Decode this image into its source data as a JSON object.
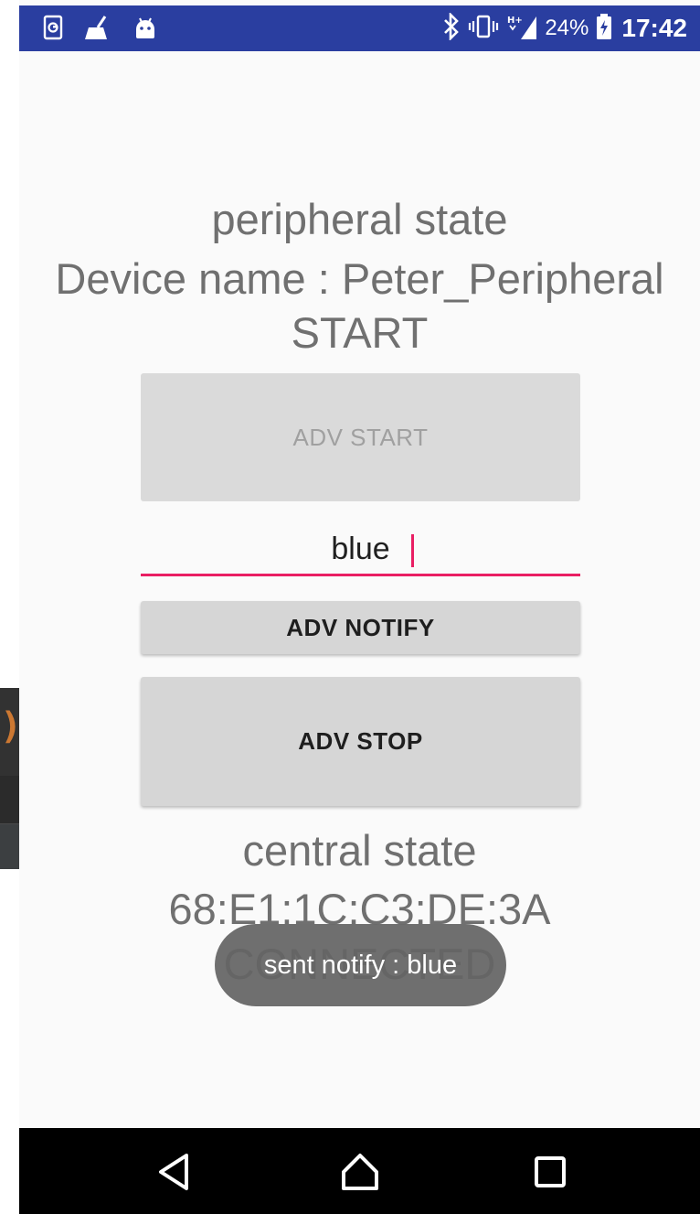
{
  "ide_fragment": {
    "code_text": ");"
  },
  "status_bar": {
    "battery_percent": "24%",
    "time": "17:42",
    "left_icons": [
      "screen-record-icon",
      "broom-icon",
      "android-debug-icon"
    ],
    "right_icons": [
      "bluetooth-icon",
      "vibrate-icon",
      "mobile-signal-h-plus-icon",
      "battery-charging-icon"
    ]
  },
  "peripheral": {
    "state_label": "peripheral state",
    "device_name_label": "Device name : Peter_Peripheral",
    "status": "START"
  },
  "buttons": {
    "adv_start": "ADV START",
    "adv_notify": "ADV NOTIFY",
    "adv_stop": "ADV STOP"
  },
  "notify_input": {
    "value": "blue"
  },
  "central": {
    "state_label": "central state",
    "address": "68:E1:1C:C3:DE:3A",
    "status": "CONNECTED"
  },
  "toast": {
    "message": "sent notify : blue"
  },
  "nav_bar": {
    "icons": [
      "back-icon",
      "home-icon",
      "recents-icon"
    ]
  },
  "colors": {
    "status_bar": "#2a3ea0",
    "accent": "#e91e63",
    "text_secondary": "#707070",
    "button_bg": "#d6d6d6"
  }
}
